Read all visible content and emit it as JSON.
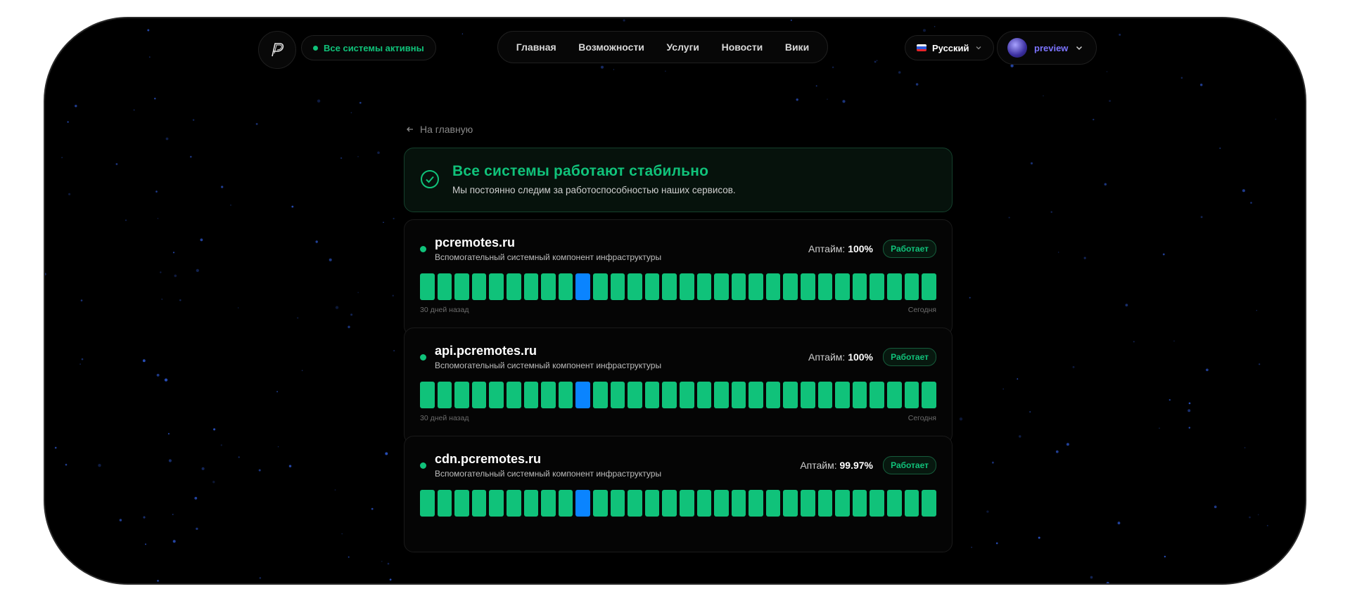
{
  "header": {
    "status_pill": "Все системы активны",
    "nav": [
      "Главная",
      "Возможности",
      "Услуги",
      "Новости",
      "Вики"
    ],
    "language": "Русский",
    "username": "preview"
  },
  "back_link": "На главную",
  "banner": {
    "title": "Все системы работают стабильно",
    "subtitle": "Мы постоянно следим за работоспособностью наших сервисов."
  },
  "services": [
    {
      "name": "pcremotes.ru",
      "description": "Вспомогательный системный компонент инфраструктуры",
      "uptime_label": "Аптайм:",
      "uptime": "100%",
      "status": "Работает",
      "label_left": "30 дней назад",
      "label_right": "Сегодня"
    },
    {
      "name": "api.pcremotes.ru",
      "description": "Вспомогательный системный компонент инфраструктуры",
      "uptime_label": "Аптайм:",
      "uptime": "100%",
      "status": "Работает",
      "label_left": "30 дней назад",
      "label_right": "Сегодня"
    },
    {
      "name": "cdn.pcremotes.ru",
      "description": "Вспомогательный системный компонент инфраструктуры",
      "uptime_label": "Аптайм:",
      "uptime": "99.97%",
      "status": "Работает",
      "label_left": "",
      "label_right": ""
    }
  ],
  "history": {
    "days": 30,
    "highlighted_day_index": 9
  },
  "colors": {
    "ok": "#10c27a",
    "highlight": "#0a84ff",
    "user_accent": "#7c74ff",
    "background": "#000000"
  },
  "icons": {
    "logo": "p-logo-icon",
    "back": "arrow-left-icon",
    "banner": "check-circle-icon",
    "dropdown": "chevron-down-icon"
  }
}
